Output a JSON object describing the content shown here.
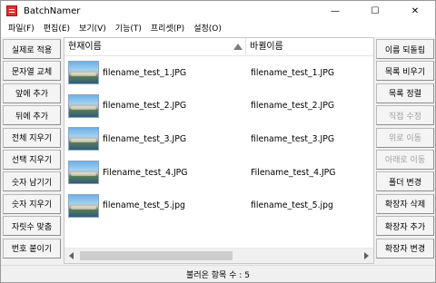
{
  "window": {
    "title": "BatchNamer",
    "icon": "app-list-icon",
    "controls": [
      "minimize-icon",
      "maximize-icon",
      "close-icon"
    ]
  },
  "menu": [
    {
      "label": "파일(F)"
    },
    {
      "label": "편집(E)"
    },
    {
      "label": "보기(V)"
    },
    {
      "label": "기능(T)"
    },
    {
      "label": "프리셋(P)"
    },
    {
      "label": "설정(O)"
    }
  ],
  "left_buttons": [
    {
      "label": "실제로 적용"
    },
    {
      "label": "문자열 교체"
    },
    {
      "label": "앞에 추가"
    },
    {
      "label": "뒤에 추가"
    },
    {
      "label": "전체 지우기"
    },
    {
      "label": "선택 지우기"
    },
    {
      "label": "숫자 남기기"
    },
    {
      "label": "숫자 지우기"
    },
    {
      "label": "자릿수 맞춤"
    },
    {
      "label": "번호 붙이기"
    }
  ],
  "right_buttons": [
    {
      "label": "이름 되돌림",
      "enabled": true
    },
    {
      "label": "목록 비우기",
      "enabled": true
    },
    {
      "label": "목록 정렬",
      "enabled": true
    },
    {
      "label": "직접 수정",
      "enabled": false
    },
    {
      "label": "위로 이동",
      "enabled": false
    },
    {
      "label": "아래로 이동",
      "enabled": false
    },
    {
      "label": "폴더 변경",
      "enabled": true
    },
    {
      "label": "확장자 삭제",
      "enabled": true
    },
    {
      "label": "확장자 추가",
      "enabled": true
    },
    {
      "label": "확장자 변경",
      "enabled": true
    }
  ],
  "list": {
    "columns": [
      "현재이름",
      "바뀔이름"
    ],
    "sort_icon": "sort-up-icon",
    "rows": [
      {
        "current": "filename_test_1.JPG",
        "new": "filename_test_1.JPG",
        "thumb": "image-thumbnail"
      },
      {
        "current": "filename_test_2.JPG",
        "new": "filename_test_2.JPG",
        "thumb": "image-thumbnail"
      },
      {
        "current": "filename_test_3.JPG",
        "new": "filename_test_3.JPG",
        "thumb": "image-thumbnail"
      },
      {
        "current": "Filename_test_4.JPG",
        "new": "Filename_test_4.JPG",
        "thumb": "image-thumbnail"
      },
      {
        "current": "filename_test_5.jpg",
        "new": "filename_test_5.jpg",
        "thumb": "image-thumbnail"
      }
    ]
  },
  "status": {
    "text": "불러온 항목 수 : 5"
  }
}
